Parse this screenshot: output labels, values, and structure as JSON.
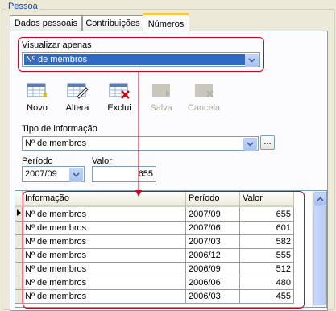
{
  "group_title": "Pessoa",
  "tabs": [
    "Dados pessoais",
    "Contribuições",
    "Números"
  ],
  "view": {
    "label": "Visualizar apenas",
    "value": "Nº de membros"
  },
  "toolbar": [
    {
      "label": "Novo",
      "enabled": true
    },
    {
      "label": "Altera",
      "enabled": true
    },
    {
      "label": "Exclui",
      "enabled": true
    },
    {
      "label": "Salva",
      "enabled": false
    },
    {
      "label": "Cancela",
      "enabled": false
    }
  ],
  "info": {
    "label": "Tipo de informação",
    "value": "Nº de membros",
    "ellipsis": "..."
  },
  "period": {
    "label": "Período",
    "value": "2007/09"
  },
  "value_field": {
    "label": "Valor",
    "value": "655"
  },
  "grid": {
    "columns": [
      "Informação",
      "Período",
      "Valor"
    ],
    "rows": [
      [
        "Nº de membros",
        "2007/09",
        "655"
      ],
      [
        "Nº de membros",
        "2007/06",
        "601"
      ],
      [
        "Nº de membros",
        "2007/03",
        "582"
      ],
      [
        "Nº de membros",
        "2006/12",
        "555"
      ],
      [
        "Nº de membros",
        "2006/09",
        "512"
      ],
      [
        "Nº de membros",
        "2006/06",
        "480"
      ],
      [
        "Nº de membros",
        "2006/03",
        "455"
      ]
    ]
  },
  "colors": {
    "highlight": "#d4001e",
    "selection": "#316ac5",
    "tab_accent": "#ffc83c"
  }
}
